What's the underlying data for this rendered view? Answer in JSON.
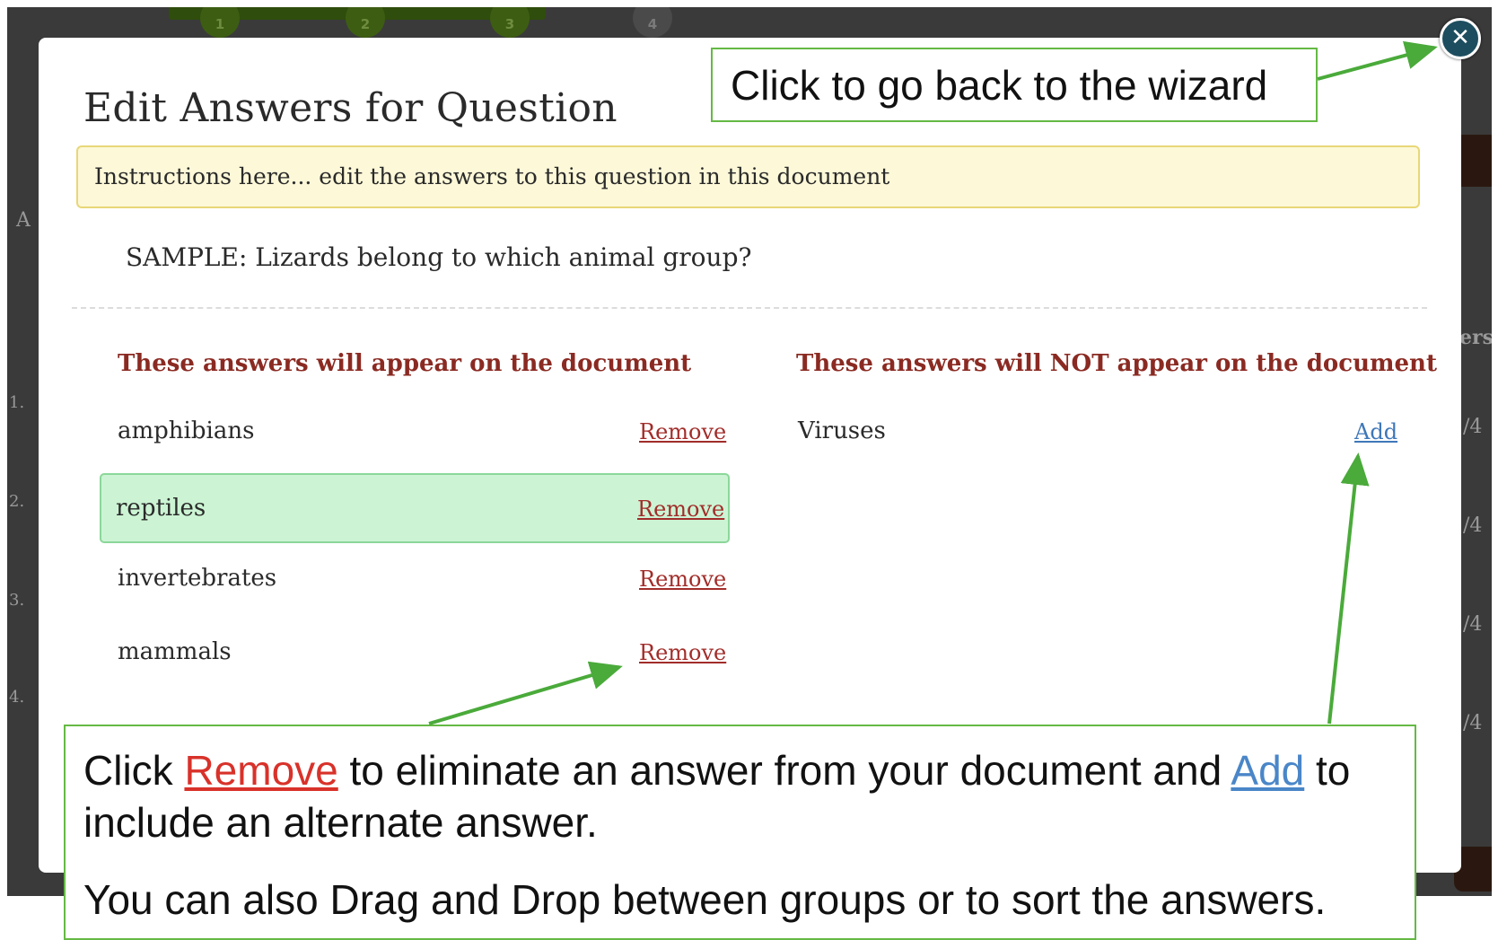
{
  "background": {
    "steps": [
      "1",
      "2",
      "3",
      "4"
    ],
    "fragments": [
      "A",
      "1.",
      "2.",
      "3.",
      "4.",
      "ers",
      "/4",
      "/4",
      "/4",
      "/4"
    ]
  },
  "modal": {
    "title": "Edit Answers for Question",
    "instructions": "Instructions here... edit the answers to this question in this document",
    "question": "SAMPLE: Lizards belong to which animal group?",
    "included": {
      "heading": "These answers will appear on the document",
      "answers": [
        {
          "label": "amphibians",
          "action": "Remove"
        },
        {
          "label": "reptiles",
          "action": "Remove"
        },
        {
          "label": "invertebrates",
          "action": "Remove"
        },
        {
          "label": "mammals",
          "action": "Remove"
        }
      ]
    },
    "excluded": {
      "heading": "These answers will NOT appear on the document",
      "answers": [
        {
          "label": "Viruses",
          "action": "Add"
        }
      ]
    }
  },
  "close_glyph": "✕",
  "callouts": {
    "top": "Click to go back to the wizard",
    "bottom": {
      "line1_pre": "Click ",
      "remove_word": "Remove",
      "line1_mid": " to eliminate an answer from your document and ",
      "add_word": "Add",
      "line1_post": " to include an alternate answer.",
      "line2": "You can also Drag and Drop between groups or to sort the answers."
    }
  },
  "colors": {
    "arrow": "#4aaa3a",
    "callout_border": "#65b944",
    "remove_link": "#a12d2a",
    "add_link": "#3f77b8",
    "heading": "#8a2a22",
    "highlight_row": "#ccf4d4",
    "instructions_bg": "#fcf8d8"
  }
}
